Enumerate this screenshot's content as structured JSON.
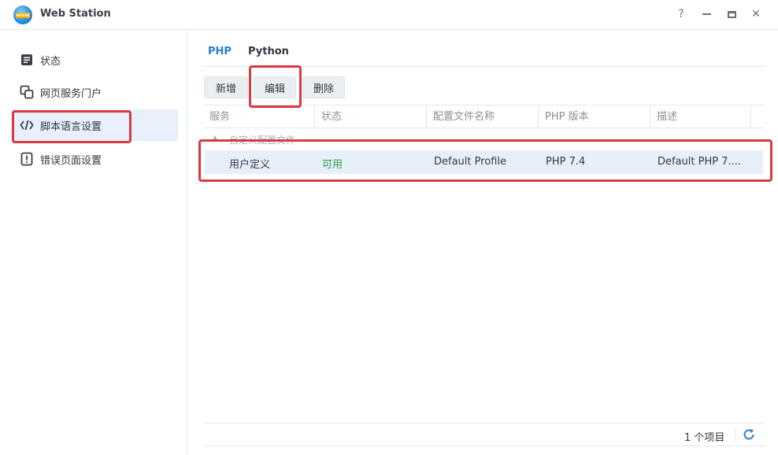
{
  "window": {
    "title": "Web Station",
    "logo_text": "www",
    "help_glyph": "?",
    "close_glyph": "✕"
  },
  "sidebar": {
    "items": [
      {
        "label": "状态",
        "icon": "status-list-icon"
      },
      {
        "label": "网页服务门户",
        "icon": "web-portal-icon"
      },
      {
        "label": "脚本语言设置",
        "icon": "code-icon",
        "active": true
      },
      {
        "label": "错误页面设置",
        "icon": "error-page-icon"
      }
    ]
  },
  "tabs": [
    {
      "label": "PHP",
      "active": true
    },
    {
      "label": "Python"
    }
  ],
  "toolbar": {
    "add_label": "新增",
    "edit_label": "编辑",
    "delete_label": "删除"
  },
  "grid": {
    "columns": [
      "服务",
      "状态",
      "配置文件名称",
      "PHP 版本",
      "描述"
    ],
    "group_label": "自定义配置文件",
    "rows": [
      {
        "service": "用户定义",
        "status": "可用",
        "profile": "Default Profile",
        "php_version": "PHP 7.4",
        "description": "Default PHP 7...."
      }
    ]
  },
  "footer": {
    "count": "1 个项目"
  },
  "colors": {
    "accent": "#2b7cd3",
    "status_ok": "#2e9b3a",
    "highlight": "#d93a3f",
    "selected_row": "#e6effa"
  }
}
